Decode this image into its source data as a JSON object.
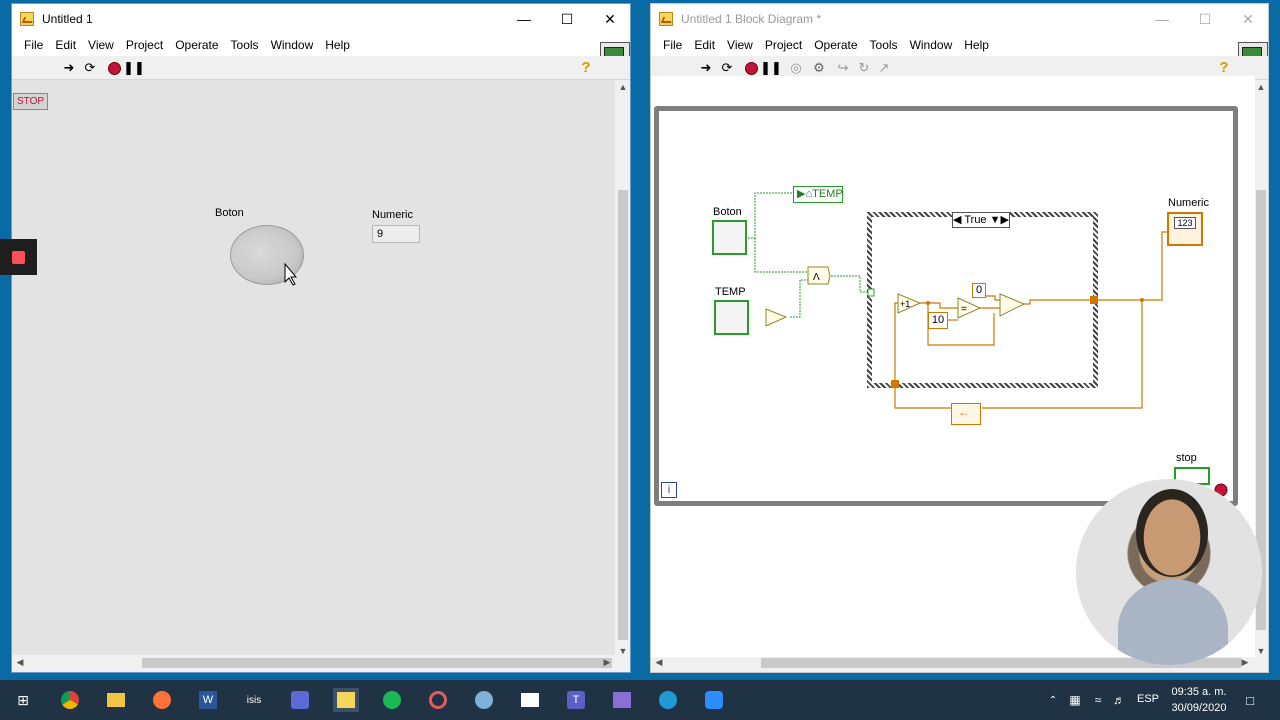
{
  "front_panel": {
    "title": "Untitled 1",
    "menu": [
      "File",
      "Edit",
      "View",
      "Project",
      "Operate",
      "Tools",
      "Window",
      "Help"
    ],
    "stop_label": "STOP",
    "boton_label": "Boton",
    "numeric_label": "Numeric",
    "numeric_value": "9"
  },
  "block_diagram": {
    "title": "Untitled 1 Block Diagram *",
    "menu": [
      "File",
      "Edit",
      "View",
      "Project",
      "Operate",
      "Tools",
      "Window",
      "Help"
    ],
    "boton_label": "Boton",
    "temp_label": "TEMP",
    "local_var_label": "TEMP",
    "case_selector": "True",
    "const_zero": "0",
    "const_ten": "10",
    "numeric_label": "Numeric",
    "numeric_term_text": "123",
    "stop_label": "stop",
    "iteration_label": "i"
  },
  "taskbar": {
    "time": "09:35 a. m.",
    "date": "30/09/2020",
    "language": "ESP"
  },
  "colors": {
    "boolean_green": "#2a9c2a",
    "numeric_orange": "#d07700",
    "stop_red": "#c0143c",
    "taskbar": "#1f3344"
  }
}
